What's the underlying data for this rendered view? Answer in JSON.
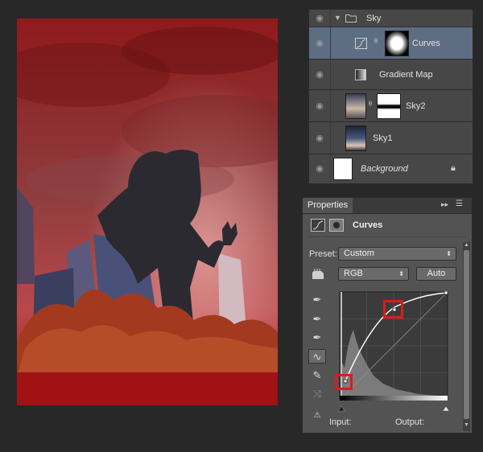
{
  "layers": [
    {
      "name": "Sky",
      "type": "group",
      "expanded": true
    },
    {
      "name": "Curves",
      "type": "adjustment",
      "selected": true
    },
    {
      "name": "Gradient Map",
      "type": "adjustment"
    },
    {
      "name": "Sky2",
      "type": "masked-image"
    },
    {
      "name": "Sky1",
      "type": "image"
    },
    {
      "name": "Background",
      "type": "background",
      "italic": true,
      "locked": true
    }
  ],
  "properties": {
    "tab": "Properties",
    "header": "Curves",
    "preset_label": "Preset:",
    "preset_value": "Custom",
    "channel_value": "RGB",
    "auto_button": "Auto",
    "input_label": "Input:",
    "output_label": "Output:"
  },
  "icons": [
    "eye-icon",
    "folder-icon",
    "chain-link-icon",
    "lock-icon",
    "curves-adjust-icon",
    "mask-icon",
    "on-image-adjust-icon",
    "eyedropper-icon",
    "curve-tool-icon",
    "pencil-icon",
    "smooth-icon",
    "clipping-warning-icon"
  ],
  "colors": {
    "panel": "#535353",
    "layers_panel": "#474747",
    "selected_row": "#5d6d82",
    "highlight": "#d81d1d",
    "image_tint": "#9b1c1c"
  }
}
